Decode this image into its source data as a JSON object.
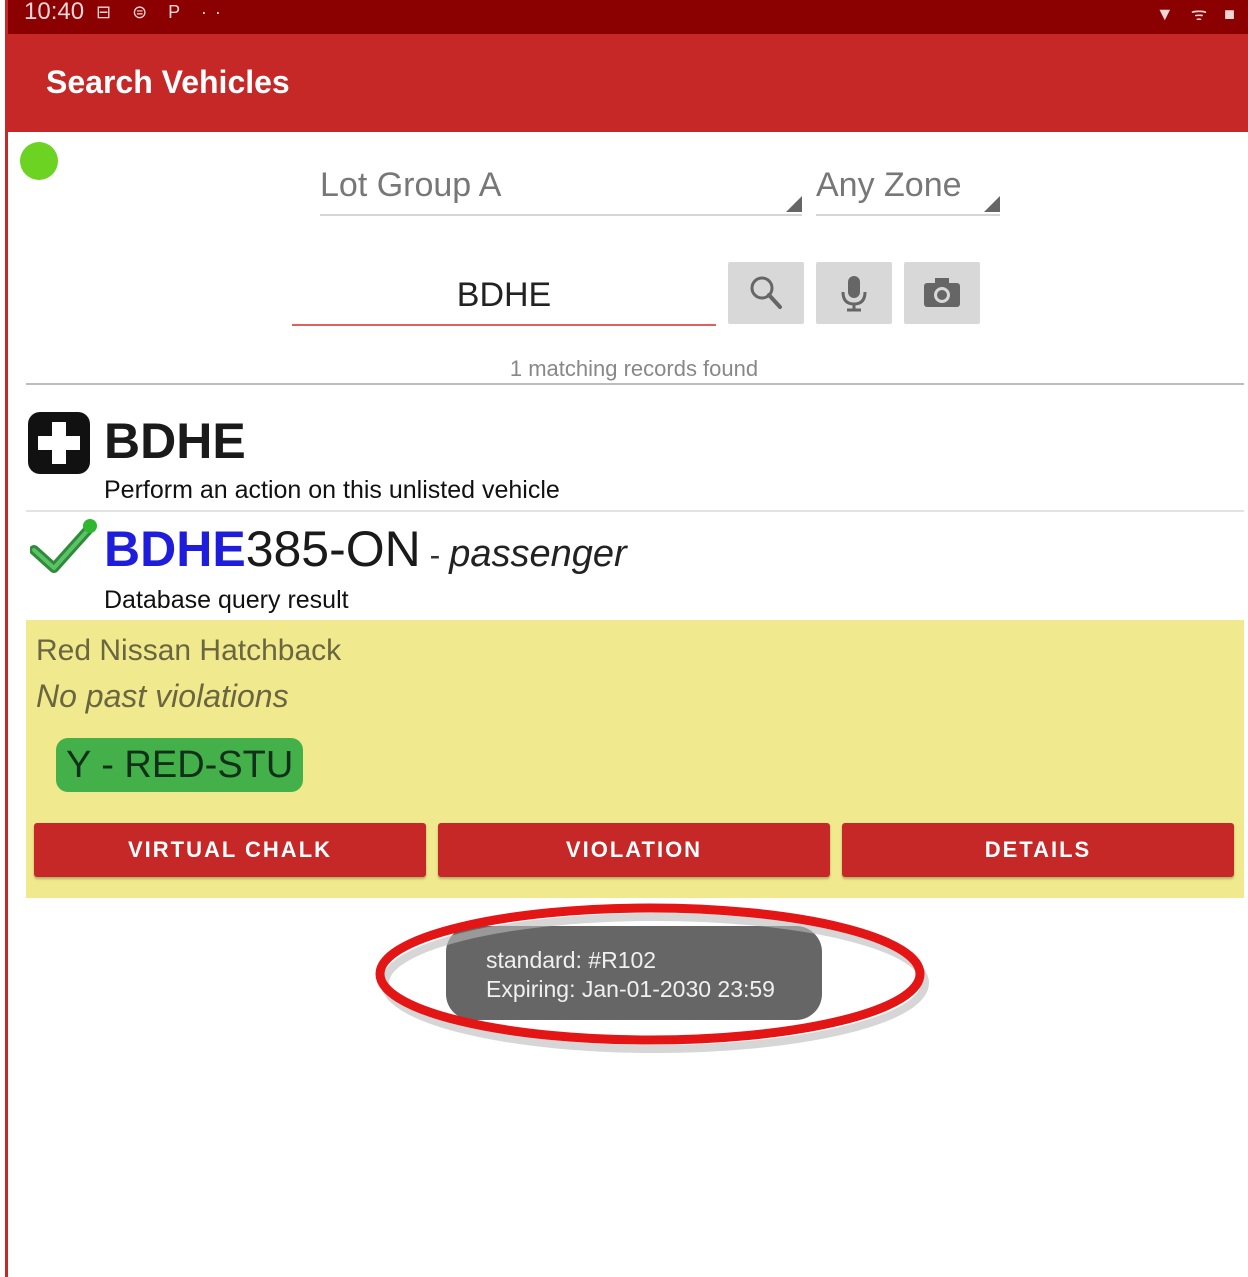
{
  "status_bar": {
    "time": "10:40",
    "notification_icons": "⊟ ⊜ P ··",
    "system_icons": "▼ ᯤ ■"
  },
  "app_bar": {
    "title": "Search Vehicles"
  },
  "filters": {
    "lot_group": "Lot Group A",
    "zone": "Any Zone"
  },
  "search": {
    "query": "BDHE",
    "buttons": {
      "search": "search-icon",
      "voice": "mic-icon",
      "camera": "camera-icon"
    }
  },
  "results": {
    "count_text": "1 matching records found",
    "unlisted": {
      "plate": "BDHE",
      "description": "Perform an action on this unlisted vehicle"
    },
    "match": {
      "plate_matched": "BDHE",
      "plate_rest": "385-ON",
      "separator": " - ",
      "vehicle_type": "passenger",
      "source": "Database query result",
      "vehicle_description": "Red Nissan Hatchback",
      "violations_note": "No past violations",
      "permit_badge": "Y - RED-STU",
      "actions": {
        "virtual_chalk": "VIRTUAL CHALK",
        "violation": "VIOLATION",
        "details": "DETAILS"
      }
    }
  },
  "toast": {
    "line1": "standard: #R102",
    "line2": "Expiring: Jan-01-2030 23:59"
  },
  "colors": {
    "app_bar": "#c62828",
    "status_bar": "#8b0000",
    "panel": "#f0e98e",
    "badge": "#43b049",
    "plate_match": "#1d1ddb",
    "highlight": "#e31515"
  }
}
